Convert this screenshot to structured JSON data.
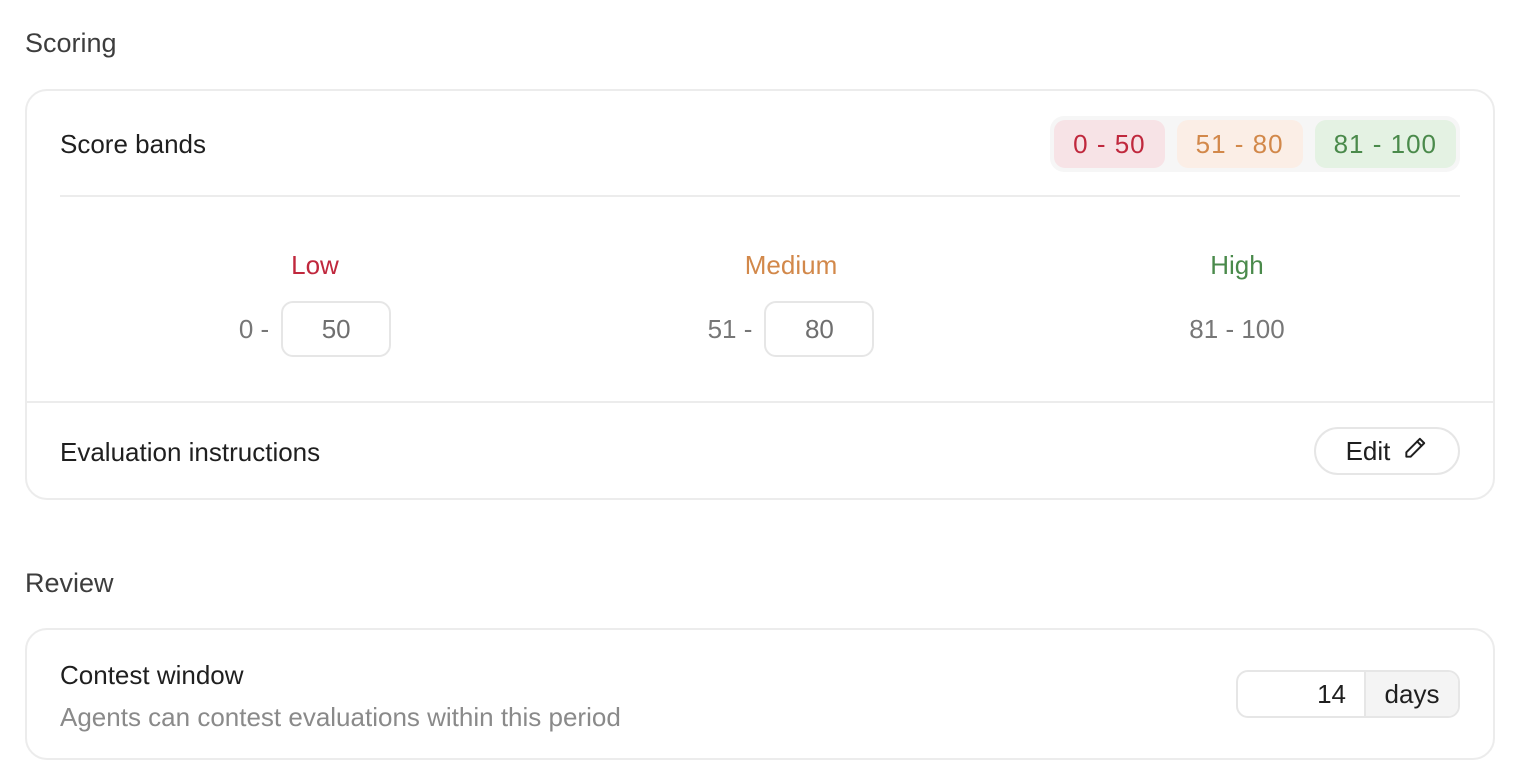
{
  "scoring": {
    "section_title": "Scoring",
    "score_bands_label": "Score bands",
    "pills": {
      "low": "0 - 50",
      "medium": "51 - 80",
      "high": "81 - 100"
    },
    "bands": {
      "low": {
        "name": "Low",
        "prefix": "0 -",
        "max_value": "50"
      },
      "medium": {
        "name": "Medium",
        "prefix": "51 -",
        "max_value": "80"
      },
      "high": {
        "name": "High",
        "range": "81 - 100"
      }
    },
    "evaluation_label": "Evaluation instructions",
    "edit_label": "Edit"
  },
  "review": {
    "section_title": "Review",
    "contest_window_label": "Contest window",
    "contest_window_description": "Agents can contest evaluations within this period",
    "contest_days_value": "14",
    "contest_days_suffix": "days"
  },
  "colors": {
    "low": "#c0283d",
    "medium": "#d2884a",
    "high": "#4a8a4b"
  },
  "icons": {
    "edit": "pencil-icon"
  }
}
